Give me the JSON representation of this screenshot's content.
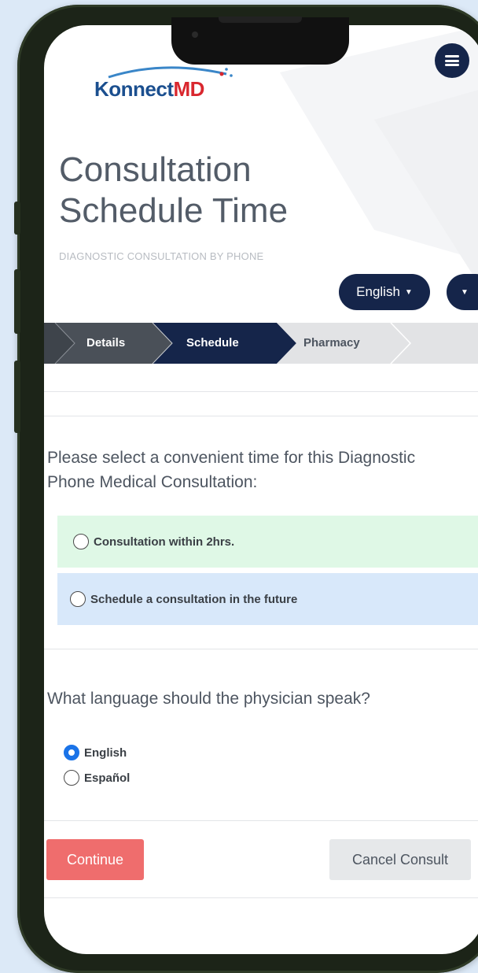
{
  "app": {
    "logo_text_prefix": "Konnect",
    "logo_text_accent": "MD",
    "page_title_line1": "Consultation",
    "page_title_line2": "Schedule Time",
    "subtitle": "DIAGNOSTIC CONSULTATION BY PHONE",
    "language_button": "English",
    "menu_icon": "hamburger-menu-icon",
    "colors": {
      "navy": "#15254a",
      "step_active": "#15254a",
      "step_done": "#4a5058",
      "step_pending": "#e2e3e5",
      "option1_bg": "#dff8e6",
      "option2_bg": "#d8e8fa",
      "continue_bg": "#ef6d6d",
      "cancel_bg": "#e6e8ea"
    }
  },
  "steps": [
    {
      "label": "Details",
      "state": "done"
    },
    {
      "label": "Schedule",
      "state": "active"
    },
    {
      "label": "Pharmacy",
      "state": "pending"
    }
  ],
  "time_section": {
    "question": "Please select a convenient time for this Diagnostic Phone Medical Consultation:",
    "options": [
      {
        "label": "Consultation within 2hrs.",
        "selected": false
      },
      {
        "label": "Schedule a consultation in the future",
        "selected": false
      }
    ]
  },
  "language_section": {
    "question": "What language should the physician speak?",
    "options": [
      {
        "label": "English",
        "selected": true
      },
      {
        "label": "Español",
        "selected": false
      }
    ]
  },
  "actions": {
    "continue": "Continue",
    "cancel": "Cancel Consult"
  }
}
